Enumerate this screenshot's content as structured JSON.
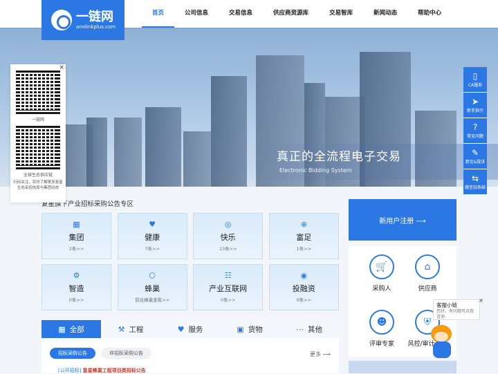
{
  "logo": {
    "cn": "一链网",
    "en": "onelinkplus.com"
  },
  "nav": [
    {
      "label": "首页",
      "active": true
    },
    {
      "label": "公司信息"
    },
    {
      "label": "交易信息"
    },
    {
      "label": "供应商资源库"
    },
    {
      "label": "交易智库"
    },
    {
      "label": "新闻动态"
    },
    {
      "label": "帮助中心"
    }
  ],
  "hero": {
    "title": "真正的全流程电子交易",
    "subtitle": "Electronic Bidding System"
  },
  "qr_panel": {
    "close": "×",
    "caption1": "一链网",
    "caption2": "全球生态供应链",
    "note": "扫码关注，实时了解更多复星生态采招信息与集团动态"
  },
  "section_title": "复星旗下产业招标采购公告专区",
  "cards": [
    {
      "title": "集团",
      "sub": "2条>>",
      "icon": "building-icon",
      "glyph": "▦"
    },
    {
      "title": "健康",
      "sub": "7条>>",
      "icon": "heart-icon",
      "glyph": "♥"
    },
    {
      "title": "快乐",
      "sub": "13条>>",
      "icon": "globe-icon",
      "glyph": "◎"
    },
    {
      "title": "富足",
      "sub": "1条>>",
      "icon": "plus-circle-icon",
      "glyph": "⊕"
    },
    {
      "title": "智造",
      "sub": "0条>>",
      "icon": "gear-icon",
      "glyph": "⚙"
    },
    {
      "title": "蜂巢",
      "sub": "前往蜂巢查看>>",
      "icon": "hexagon-icon",
      "glyph": "⬡"
    },
    {
      "title": "产业互联网",
      "sub": "0条>>",
      "icon": "network-icon",
      "glyph": "☷"
    },
    {
      "title": "投融资",
      "sub": "0条>>",
      "icon": "coin-icon",
      "glyph": "◉"
    }
  ],
  "tabs": [
    {
      "label": "全部",
      "icon": "grid-icon",
      "glyph": "▦",
      "active": true
    },
    {
      "label": "工程",
      "icon": "crane-icon",
      "glyph": "⚒"
    },
    {
      "label": "服务",
      "icon": "heart-icon",
      "glyph": "♥"
    },
    {
      "label": "货物",
      "icon": "box-icon",
      "glyph": "▣"
    },
    {
      "label": "其他",
      "icon": "more-icon",
      "glyph": "⋯"
    }
  ],
  "subtabs": [
    {
      "label": "招标采购公告",
      "active": true
    },
    {
      "label": "非招标采购公告"
    }
  ],
  "more": "更多 ⟶",
  "list_first": {
    "tag": "[公开招标]",
    "text": "复星蜂巢工程项目类招标公告"
  },
  "register": "新用户注册  ⟶",
  "roles": [
    {
      "label": "采购人",
      "icon": "cart-icon",
      "glyph": "🛒"
    },
    {
      "label": "供应商",
      "icon": "shop-icon",
      "glyph": "⌂"
    },
    {
      "label": "评审专家",
      "icon": "expert-icon",
      "glyph": "☻"
    },
    {
      "label": "风控/审计人员",
      "icon": "shield-icon",
      "glyph": "⛨"
    }
  ],
  "sidebar": [
    {
      "label": "CA服务",
      "icon": "usb-icon",
      "glyph": "▯"
    },
    {
      "label": "新手指引",
      "icon": "send-icon",
      "glyph": "➤"
    },
    {
      "label": "常见问题",
      "icon": "question-icon",
      "glyph": "?"
    },
    {
      "label": "意见&投诉",
      "icon": "edit-icon",
      "glyph": "✎"
    },
    {
      "label": "跳至旧系统",
      "icon": "switch-icon",
      "glyph": "⇆"
    }
  ],
  "chat": {
    "title": "客服小链",
    "text": "您好，有问题可点我咨询",
    "close": "×"
  },
  "colors": {
    "brand": "#2b78e4"
  }
}
